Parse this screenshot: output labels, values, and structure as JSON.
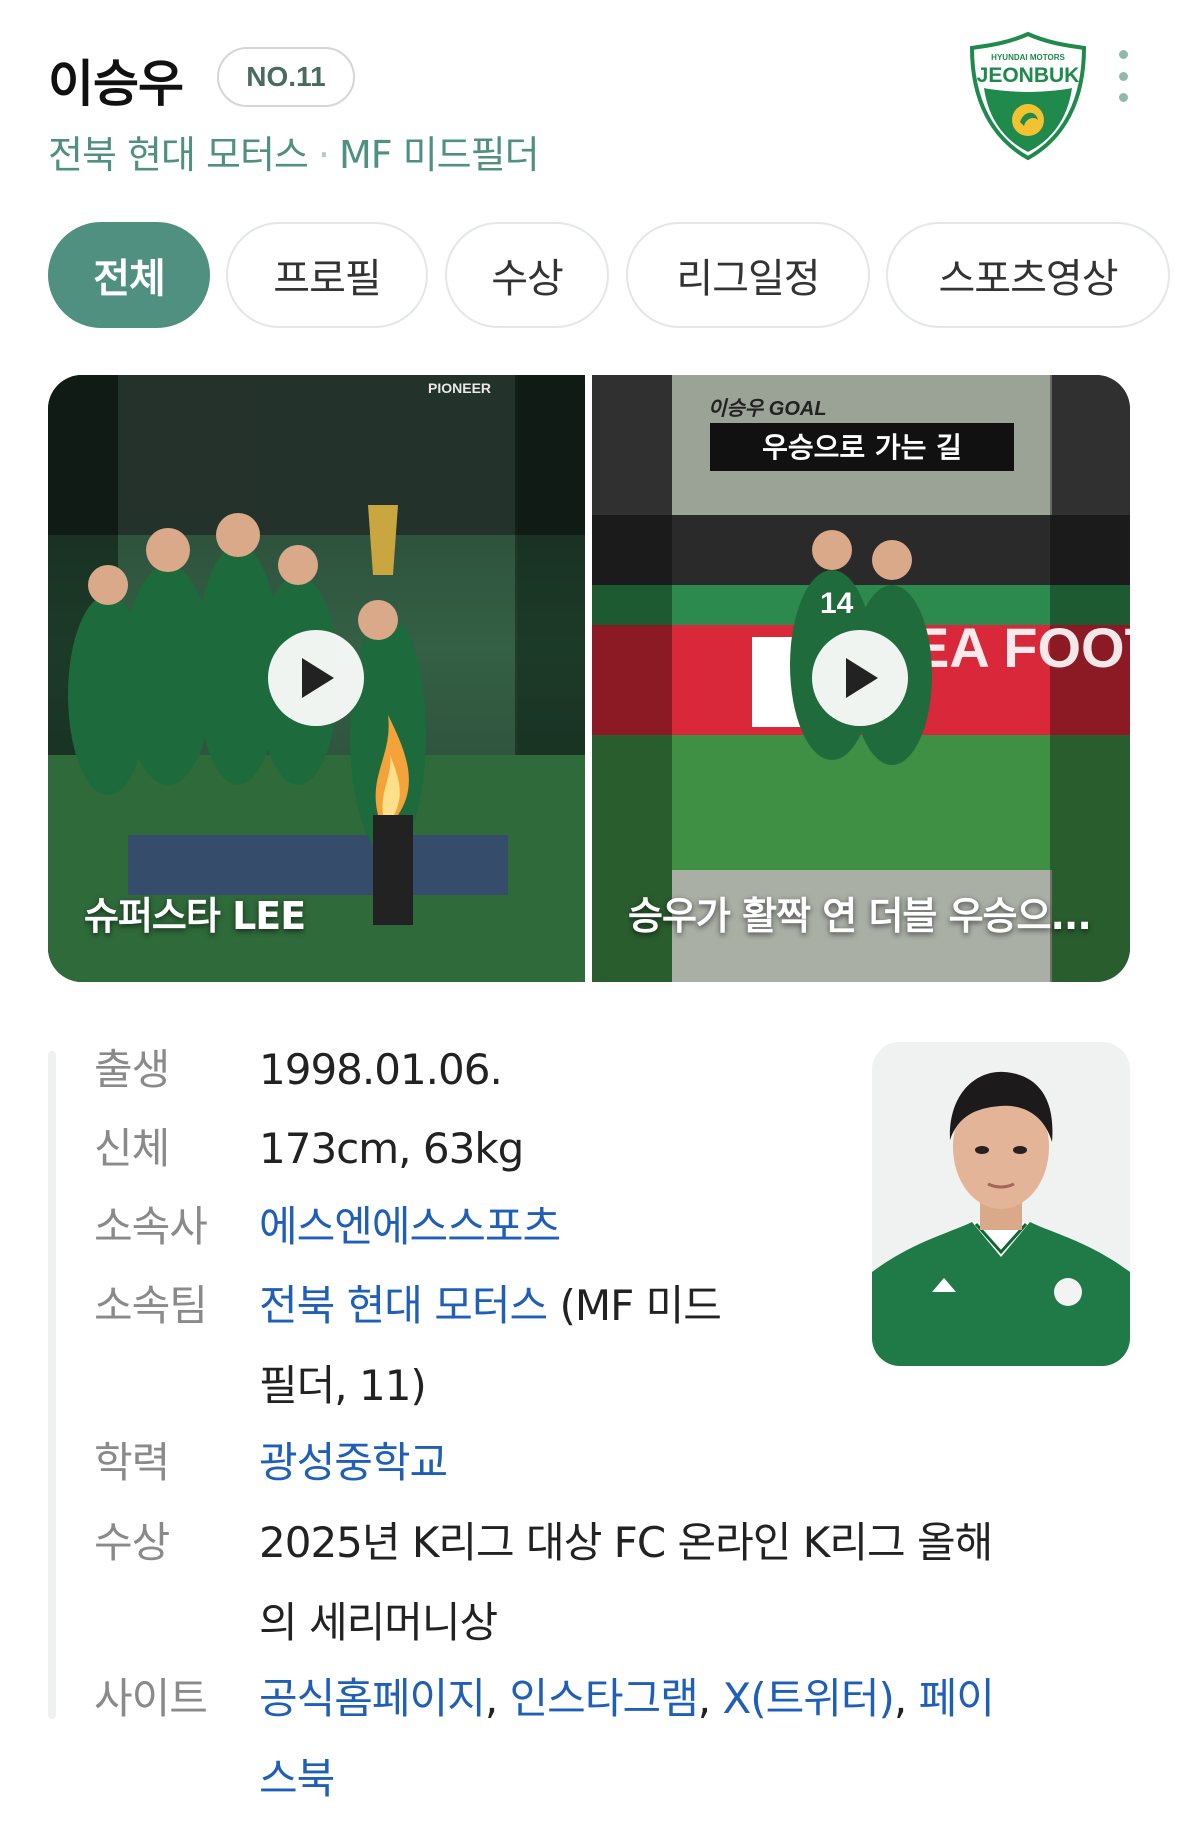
{
  "player": {
    "name": "이승우",
    "number": "NO.11",
    "team": "전북 현대 모터스",
    "separator": "·",
    "position": "MF 미드필더"
  },
  "club_logo": {
    "text_top": "HYUNDAI MOTORS",
    "text_main": "JEONBUK",
    "color": "#1f8a4c"
  },
  "tabs": [
    {
      "label": "전체",
      "active": true
    },
    {
      "label": "프로필",
      "active": false
    },
    {
      "label": "수상",
      "active": false
    },
    {
      "label": "리그일정",
      "active": false
    },
    {
      "label": "스포츠영상",
      "active": false
    }
  ],
  "videos": [
    {
      "caption": "슈퍼스타 LEE",
      "overlay_top": "PIONEER"
    },
    {
      "caption": "승우가 활짝 연 더블 우승으...",
      "overlay_tag": "이승우 GOAL",
      "overlay_title": "우승으로 가는 길",
      "banner_text": "EA FOOTOOT",
      "jersey_number": "14"
    }
  ],
  "info": {
    "birth_label": "출생",
    "birth_value": "1998.01.06.",
    "body_label": "신체",
    "body_value": "173cm, 63kg",
    "agency_label": "소속사",
    "agency_value": "에스엔에스스포츠",
    "team_label": "소속팀",
    "team_link": "전북 현대 모터스",
    "team_extra_1": " (MF 미드",
    "team_extra_2": "필더, 11)",
    "school_label": "학력",
    "school_value": "광성중학교",
    "award_label": "수상",
    "award_line_1": "2025년 K리그 대상 FC 온라인 K리그 올해",
    "award_line_2": "의 세리머니상",
    "site_label": "사이트",
    "site_1": "공식홈페이지",
    "site_2": "인스타그램",
    "site_3": "X(트위터)",
    "site_4": "페이",
    "site_4b": "스북",
    "comma": ", "
  },
  "colors": {
    "accent": "#4f9080",
    "link": "#1f5fb8",
    "label": "#8a8a8a"
  }
}
